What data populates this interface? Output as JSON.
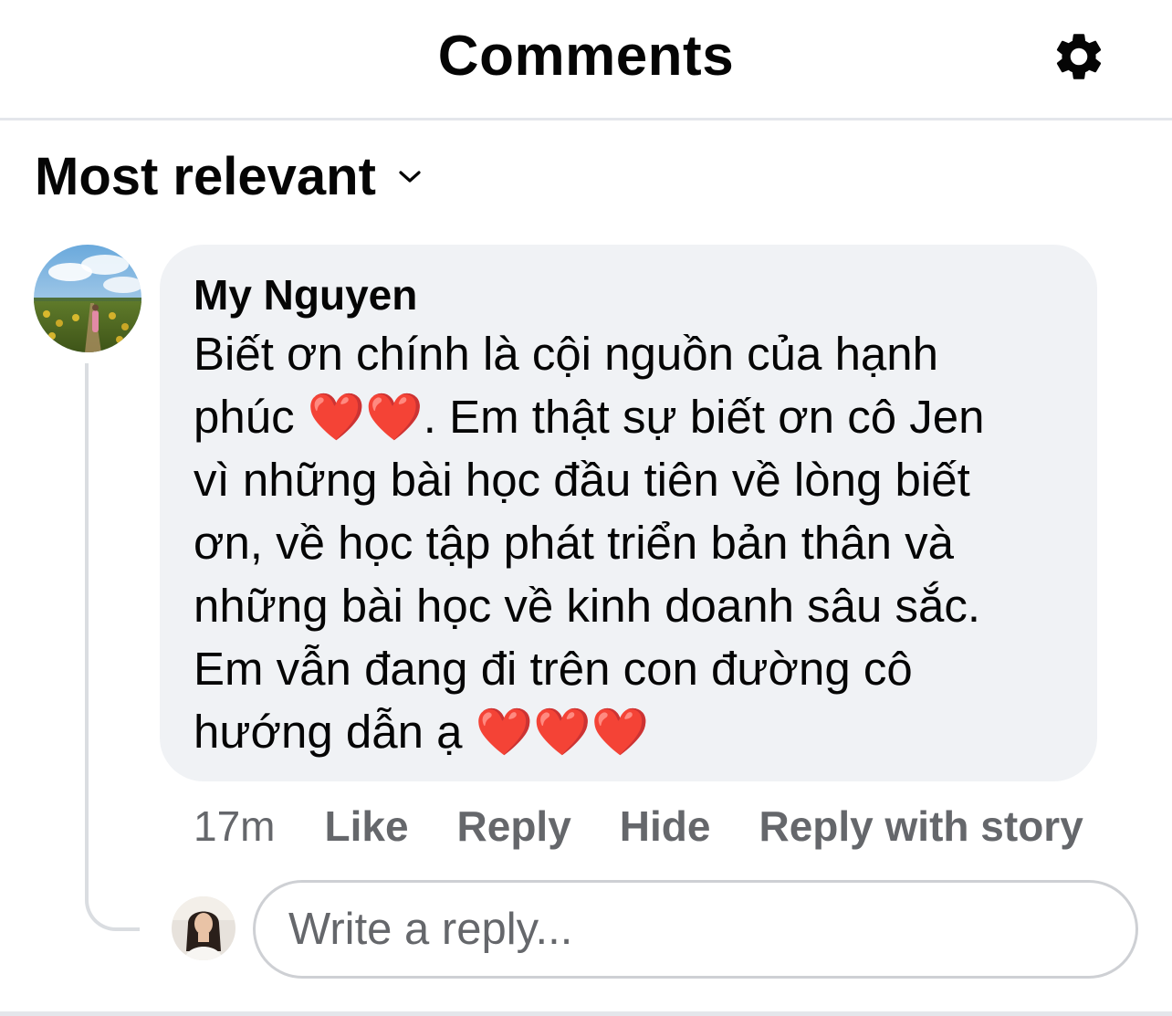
{
  "header": {
    "title": "Comments",
    "settings_icon": "gear-icon"
  },
  "sort": {
    "label": "Most relevant",
    "icon": "chevron-down-icon"
  },
  "comment": {
    "author": "My Nguyen",
    "text": "Biết ơn chính là cội nguồn của hạnh\nphúc ❤️❤️. Em thật sự biết ơn cô Jen\nvì những bài học đầu tiên về lòng biết\nơn, về học tập phát triển bản thân và\nnhững bài học về kinh doanh sâu sắc.\nEm vẫn đang đi trên con đường cô\nhướng dẫn ạ ❤️❤️❤️",
    "time": "17m",
    "actions": {
      "like": "Like",
      "reply": "Reply",
      "hide": "Hide",
      "reply_story": "Reply with story"
    }
  },
  "reply_box": {
    "placeholder": "Write a reply..."
  },
  "colors": {
    "text_primary": "#050505",
    "text_secondary": "#65676b",
    "bubble_bg": "#f0f2f5",
    "divider": "#e4e6eb",
    "heart": "#e0202e"
  }
}
